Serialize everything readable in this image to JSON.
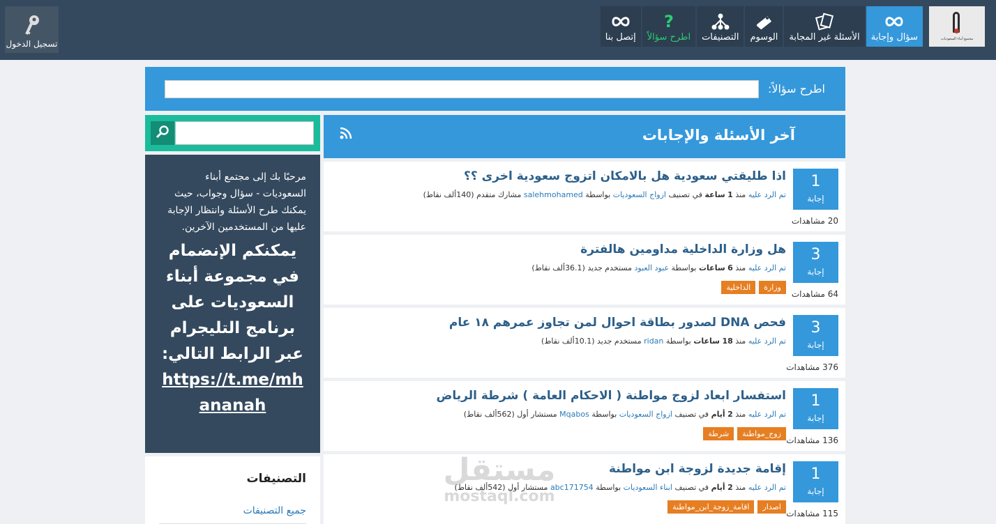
{
  "header": {
    "logo_caption": "مجتمع أبناء السعوديات",
    "nav": [
      {
        "label": "سؤال وإجابة",
        "icon": "infinity-icon",
        "active": true
      },
      {
        "label": "الأسئلة غير المجابة",
        "icon": "cards-icon",
        "active": false
      },
      {
        "label": "الوسوم",
        "icon": "tag-icon",
        "active": false
      },
      {
        "label": "التصنيفات",
        "icon": "hierarchy-icon",
        "active": false
      },
      {
        "label": "اطرح سؤالاً",
        "icon": "question-mark-icon",
        "active": false
      },
      {
        "label": "إتصل بنا",
        "icon": "infinity-icon",
        "active": false
      }
    ],
    "login_label": "تسجيل الدخول"
  },
  "ask": {
    "label": "اطرح سؤالاً:"
  },
  "sidebar": {
    "welcome_text": "مرحبًا بك إلى مجتمع أبناء السعوديات - سؤال وجواب، حيث يمكنك طرح الأسئلة وانتظار الإجابة عليها من المستخدمين الآخرين.",
    "join_text": "يمكنكم الإنضمام في مجموعة أبناء السعوديات على برنامج التليجرام عبر الرابط التالي:",
    "telegram_link": "https://t.me/mhananah",
    "categories_title": "التصنيفات",
    "all_categories": "جميع التصنيفات"
  },
  "main": {
    "title": "آخر الأسئلة والإجابات",
    "questions": [
      {
        "answers": "1",
        "answers_label": "إجابة",
        "views": "20 مشاهدات",
        "title": "اذا طليقتي سعودية هل بالامكان اتزوج سعودية اخرى ؟؟",
        "action": "تم الرد عليه",
        "when_prefix": "منذ",
        "when_num": "1",
        "when_unit": "ساعة",
        "cat_prefix": "في تصنيف",
        "category": "ازواج السعوديات",
        "by": "بواسطة",
        "user": "salehmohamed",
        "level": "مشارك متقدم (140ألف نقاط)",
        "tags": []
      },
      {
        "answers": "3",
        "answers_label": "إجابة",
        "views": "64 مشاهدات",
        "title": "هل وزارة الداخلية مداومين هالفترة",
        "action": "تم الرد عليه",
        "when_prefix": "منذ",
        "when_num": "6",
        "when_unit": "ساعات",
        "cat_prefix": "",
        "category": "",
        "by": "بواسطة",
        "user": "عبود العبود",
        "level": "مستخدم جديد (36.1ألف نقاط)",
        "tags": [
          "وزارة",
          "الداخلية"
        ]
      },
      {
        "answers": "3",
        "answers_label": "إجابة",
        "views": "376 مشاهدات",
        "title": "فحص DNA لصدور بطاقة احوال لمن تجاوز عمرهم ١٨ عام",
        "action": "تم الرد عليه",
        "when_prefix": "منذ",
        "when_num": "18",
        "when_unit": "ساعات",
        "cat_prefix": "",
        "category": "",
        "by": "بواسطة",
        "user": "ridan",
        "level": "مستخدم جديد (10.1ألف نقاط)",
        "tags": []
      },
      {
        "answers": "1",
        "answers_label": "إجابة",
        "views": "136 مشاهدات",
        "title": "استفسار ابعاد لزوج مواطنة ( الاحكام العامة ) شرطة الرياض",
        "action": "تم الرد عليه",
        "when_prefix": "منذ",
        "when_num": "2",
        "when_unit": "أيام",
        "cat_prefix": "في تصنيف",
        "category": "ازواج السعوديات",
        "by": "بواسطة",
        "user": "Mqabos",
        "level": "مستشار أول (562ألف نقاط)",
        "tags": [
          "زوج_مواطنة",
          "شرطة"
        ]
      },
      {
        "answers": "1",
        "answers_label": "إجابة",
        "views": "115 مشاهدات",
        "title": "إقامة جديدة لزوجة ابن مواطنة",
        "action": "تم الرد عليه",
        "when_prefix": "منذ",
        "when_num": "2",
        "when_unit": "أيام",
        "cat_prefix": "في تصنيف",
        "category": "ابناء السعوديات",
        "by": "بواسطة",
        "user": "abc171754",
        "level": "مستشار أول (542ألف نقاط)",
        "tags": [
          "اصدار",
          "اقامة_زوجة_ابن_مواطنة"
        ]
      }
    ]
  },
  "watermark": {
    "arabic": "مستقل",
    "latin": "mostaql.com"
  }
}
